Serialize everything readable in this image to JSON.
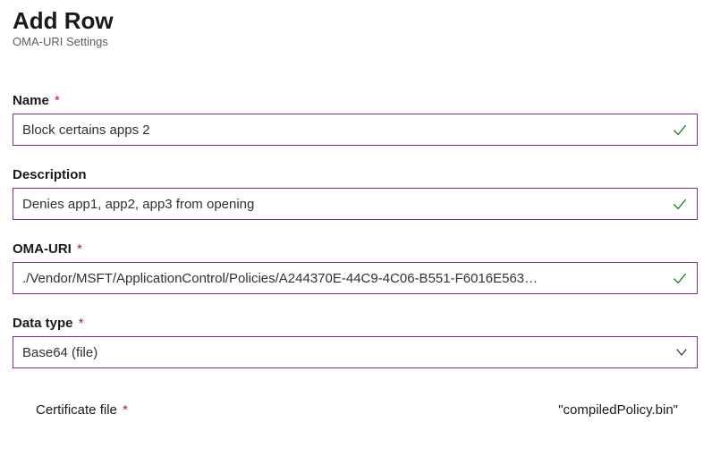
{
  "header": {
    "title": "Add Row",
    "subtitle": "OMA-URI Settings"
  },
  "fields": {
    "name": {
      "label": "Name",
      "required_marker": "*",
      "value": "Block certains apps 2",
      "validated": true
    },
    "description": {
      "label": "Description",
      "value": "Denies app1, app2, app3 from opening",
      "validated": true
    },
    "oma_uri": {
      "label": "OMA-URI",
      "required_marker": "*",
      "value": "./Vendor/MSFT/ApplicationControl/Policies/A244370E-44C9-4C06-B551-F6016E563…",
      "validated": true
    },
    "data_type": {
      "label": "Data type",
      "required_marker": "*",
      "value": "Base64 (file)"
    },
    "certificate_file": {
      "label": "Certificate file",
      "required_marker": "*",
      "file_name": "\"compiledPolicy.bin\""
    }
  }
}
